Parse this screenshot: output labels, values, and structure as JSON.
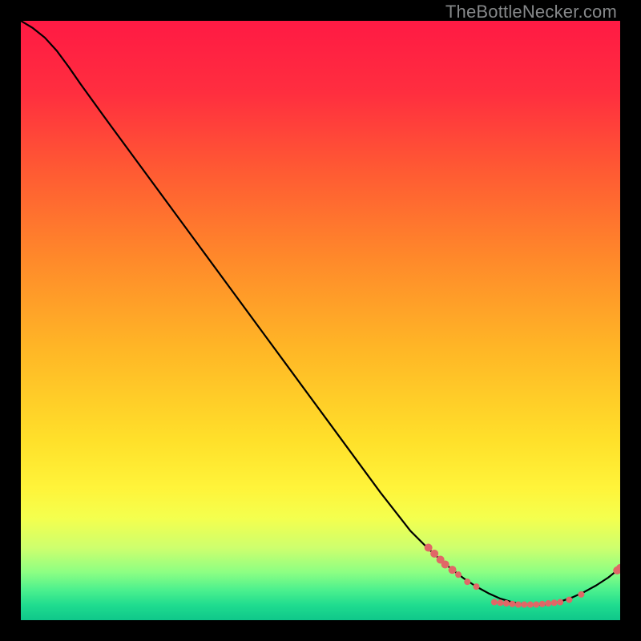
{
  "watermark": "TheBottleNecker.com",
  "chart_data": {
    "type": "line",
    "title": "",
    "xlabel": "",
    "ylabel": "",
    "xlim": [
      0,
      100
    ],
    "ylim": [
      0,
      100
    ],
    "background_gradient": {
      "stops": [
        {
          "pct": 0.0,
          "color": "#ff1a44"
        },
        {
          "pct": 0.12,
          "color": "#ff2e3f"
        },
        {
          "pct": 0.25,
          "color": "#ff5a33"
        },
        {
          "pct": 0.4,
          "color": "#ff8a2a"
        },
        {
          "pct": 0.55,
          "color": "#ffb726"
        },
        {
          "pct": 0.7,
          "color": "#ffe02a"
        },
        {
          "pct": 0.78,
          "color": "#fff43a"
        },
        {
          "pct": 0.83,
          "color": "#f4ff4e"
        },
        {
          "pct": 0.88,
          "color": "#cdff6e"
        },
        {
          "pct": 0.92,
          "color": "#8dff83"
        },
        {
          "pct": 0.95,
          "color": "#4bf08e"
        },
        {
          "pct": 0.975,
          "color": "#1fdc8f"
        },
        {
          "pct": 1.0,
          "color": "#0fc78a"
        }
      ]
    },
    "curve": [
      {
        "x": 0.0,
        "y": 100.0
      },
      {
        "x": 2.0,
        "y": 98.8
      },
      {
        "x": 4.0,
        "y": 97.2
      },
      {
        "x": 6.0,
        "y": 95.0
      },
      {
        "x": 8.0,
        "y": 92.3
      },
      {
        "x": 10.0,
        "y": 89.4
      },
      {
        "x": 15.0,
        "y": 82.5
      },
      {
        "x": 20.0,
        "y": 75.7
      },
      {
        "x": 25.0,
        "y": 68.9
      },
      {
        "x": 30.0,
        "y": 62.1
      },
      {
        "x": 35.0,
        "y": 55.3
      },
      {
        "x": 40.0,
        "y": 48.5
      },
      {
        "x": 45.0,
        "y": 41.7
      },
      {
        "x": 50.0,
        "y": 34.9
      },
      {
        "x": 55.0,
        "y": 28.1
      },
      {
        "x": 60.0,
        "y": 21.3
      },
      {
        "x": 65.0,
        "y": 14.9
      },
      {
        "x": 68.0,
        "y": 11.9
      },
      {
        "x": 70.0,
        "y": 10.1
      },
      {
        "x": 72.0,
        "y": 8.4
      },
      {
        "x": 74.0,
        "y": 6.9
      },
      {
        "x": 76.0,
        "y": 5.6
      },
      {
        "x": 78.0,
        "y": 4.5
      },
      {
        "x": 80.0,
        "y": 3.6
      },
      {
        "x": 82.0,
        "y": 3.0
      },
      {
        "x": 84.0,
        "y": 2.6
      },
      {
        "x": 86.0,
        "y": 2.5
      },
      {
        "x": 88.0,
        "y": 2.7
      },
      {
        "x": 90.0,
        "y": 3.1
      },
      {
        "x": 92.0,
        "y": 3.8
      },
      {
        "x": 94.0,
        "y": 4.7
      },
      {
        "x": 96.0,
        "y": 5.8
      },
      {
        "x": 98.0,
        "y": 7.1
      },
      {
        "x": 100.0,
        "y": 8.7
      }
    ],
    "markers": [
      {
        "x": 68.0,
        "y": 12.1,
        "r": 5
      },
      {
        "x": 69.0,
        "y": 11.1,
        "r": 5
      },
      {
        "x": 70.0,
        "y": 10.1,
        "r": 5
      },
      {
        "x": 70.8,
        "y": 9.3,
        "r": 5
      },
      {
        "x": 72.0,
        "y": 8.4,
        "r": 5
      },
      {
        "x": 73.0,
        "y": 7.6,
        "r": 4
      },
      {
        "x": 74.5,
        "y": 6.4,
        "r": 4
      },
      {
        "x": 76.0,
        "y": 5.6,
        "r": 4
      },
      {
        "x": 79.0,
        "y": 3.0,
        "r": 4
      },
      {
        "x": 80.0,
        "y": 2.9,
        "r": 4
      },
      {
        "x": 81.0,
        "y": 2.8,
        "r": 4
      },
      {
        "x": 82.0,
        "y": 2.7,
        "r": 4
      },
      {
        "x": 83.0,
        "y": 2.6,
        "r": 4
      },
      {
        "x": 84.0,
        "y": 2.6,
        "r": 4
      },
      {
        "x": 85.0,
        "y": 2.6,
        "r": 4
      },
      {
        "x": 86.0,
        "y": 2.6,
        "r": 4
      },
      {
        "x": 87.0,
        "y": 2.7,
        "r": 4
      },
      {
        "x": 88.0,
        "y": 2.8,
        "r": 4
      },
      {
        "x": 89.0,
        "y": 2.9,
        "r": 4
      },
      {
        "x": 90.0,
        "y": 3.0,
        "r": 4
      },
      {
        "x": 91.5,
        "y": 3.4,
        "r": 4
      },
      {
        "x": 93.5,
        "y": 4.3,
        "r": 4
      },
      {
        "x": 99.5,
        "y": 8.3,
        "r": 5
      },
      {
        "x": 100.0,
        "y": 8.7,
        "r": 5
      }
    ],
    "marker_color": "#e06767"
  }
}
